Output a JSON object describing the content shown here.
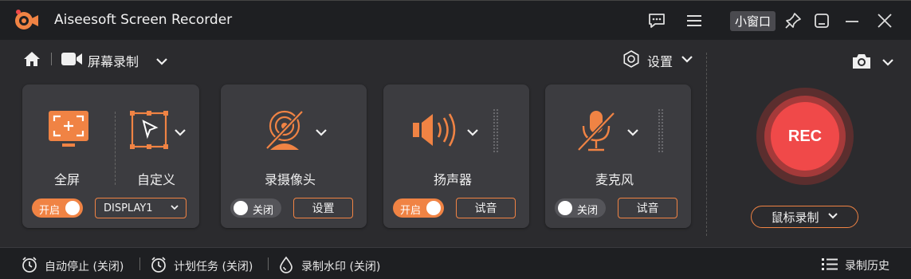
{
  "app": {
    "title": "Aiseesoft Screen Recorder",
    "mini_window_label": "小窗口",
    "accent_color": "#f08344",
    "rec_color": "#f04949"
  },
  "titlebar_icons": [
    "feedback-icon",
    "menu-icon",
    "pin-icon",
    "minimize-icon",
    "maximize-icon",
    "close-icon"
  ],
  "nav": {
    "mode_label": "屏幕录制",
    "settings_label": "设置"
  },
  "display_panel": {
    "fullscreen_label": "全屏",
    "custom_label": "自定义",
    "toggle_state": "on",
    "toggle_label": "开启",
    "display_select_value": "DISPLAY1"
  },
  "webcam_panel": {
    "label": "录摄像头",
    "toggle_state": "off",
    "toggle_label": "关闭",
    "button_label": "设置"
  },
  "speaker_panel": {
    "label": "扬声器",
    "toggle_state": "on",
    "toggle_label": "开启",
    "button_label": "试音"
  },
  "mic_panel": {
    "label": "麦克风",
    "toggle_state": "off",
    "toggle_label": "关闭",
    "button_label": "试音"
  },
  "record": {
    "rec_label": "REC",
    "mouse_record_label": "鼠标录制"
  },
  "bottom": {
    "auto_stop": "自动停止 (关闭)",
    "schedule": "计划任务 (关闭)",
    "watermark": "录制水印 (关闭)",
    "history": "录制历史"
  }
}
